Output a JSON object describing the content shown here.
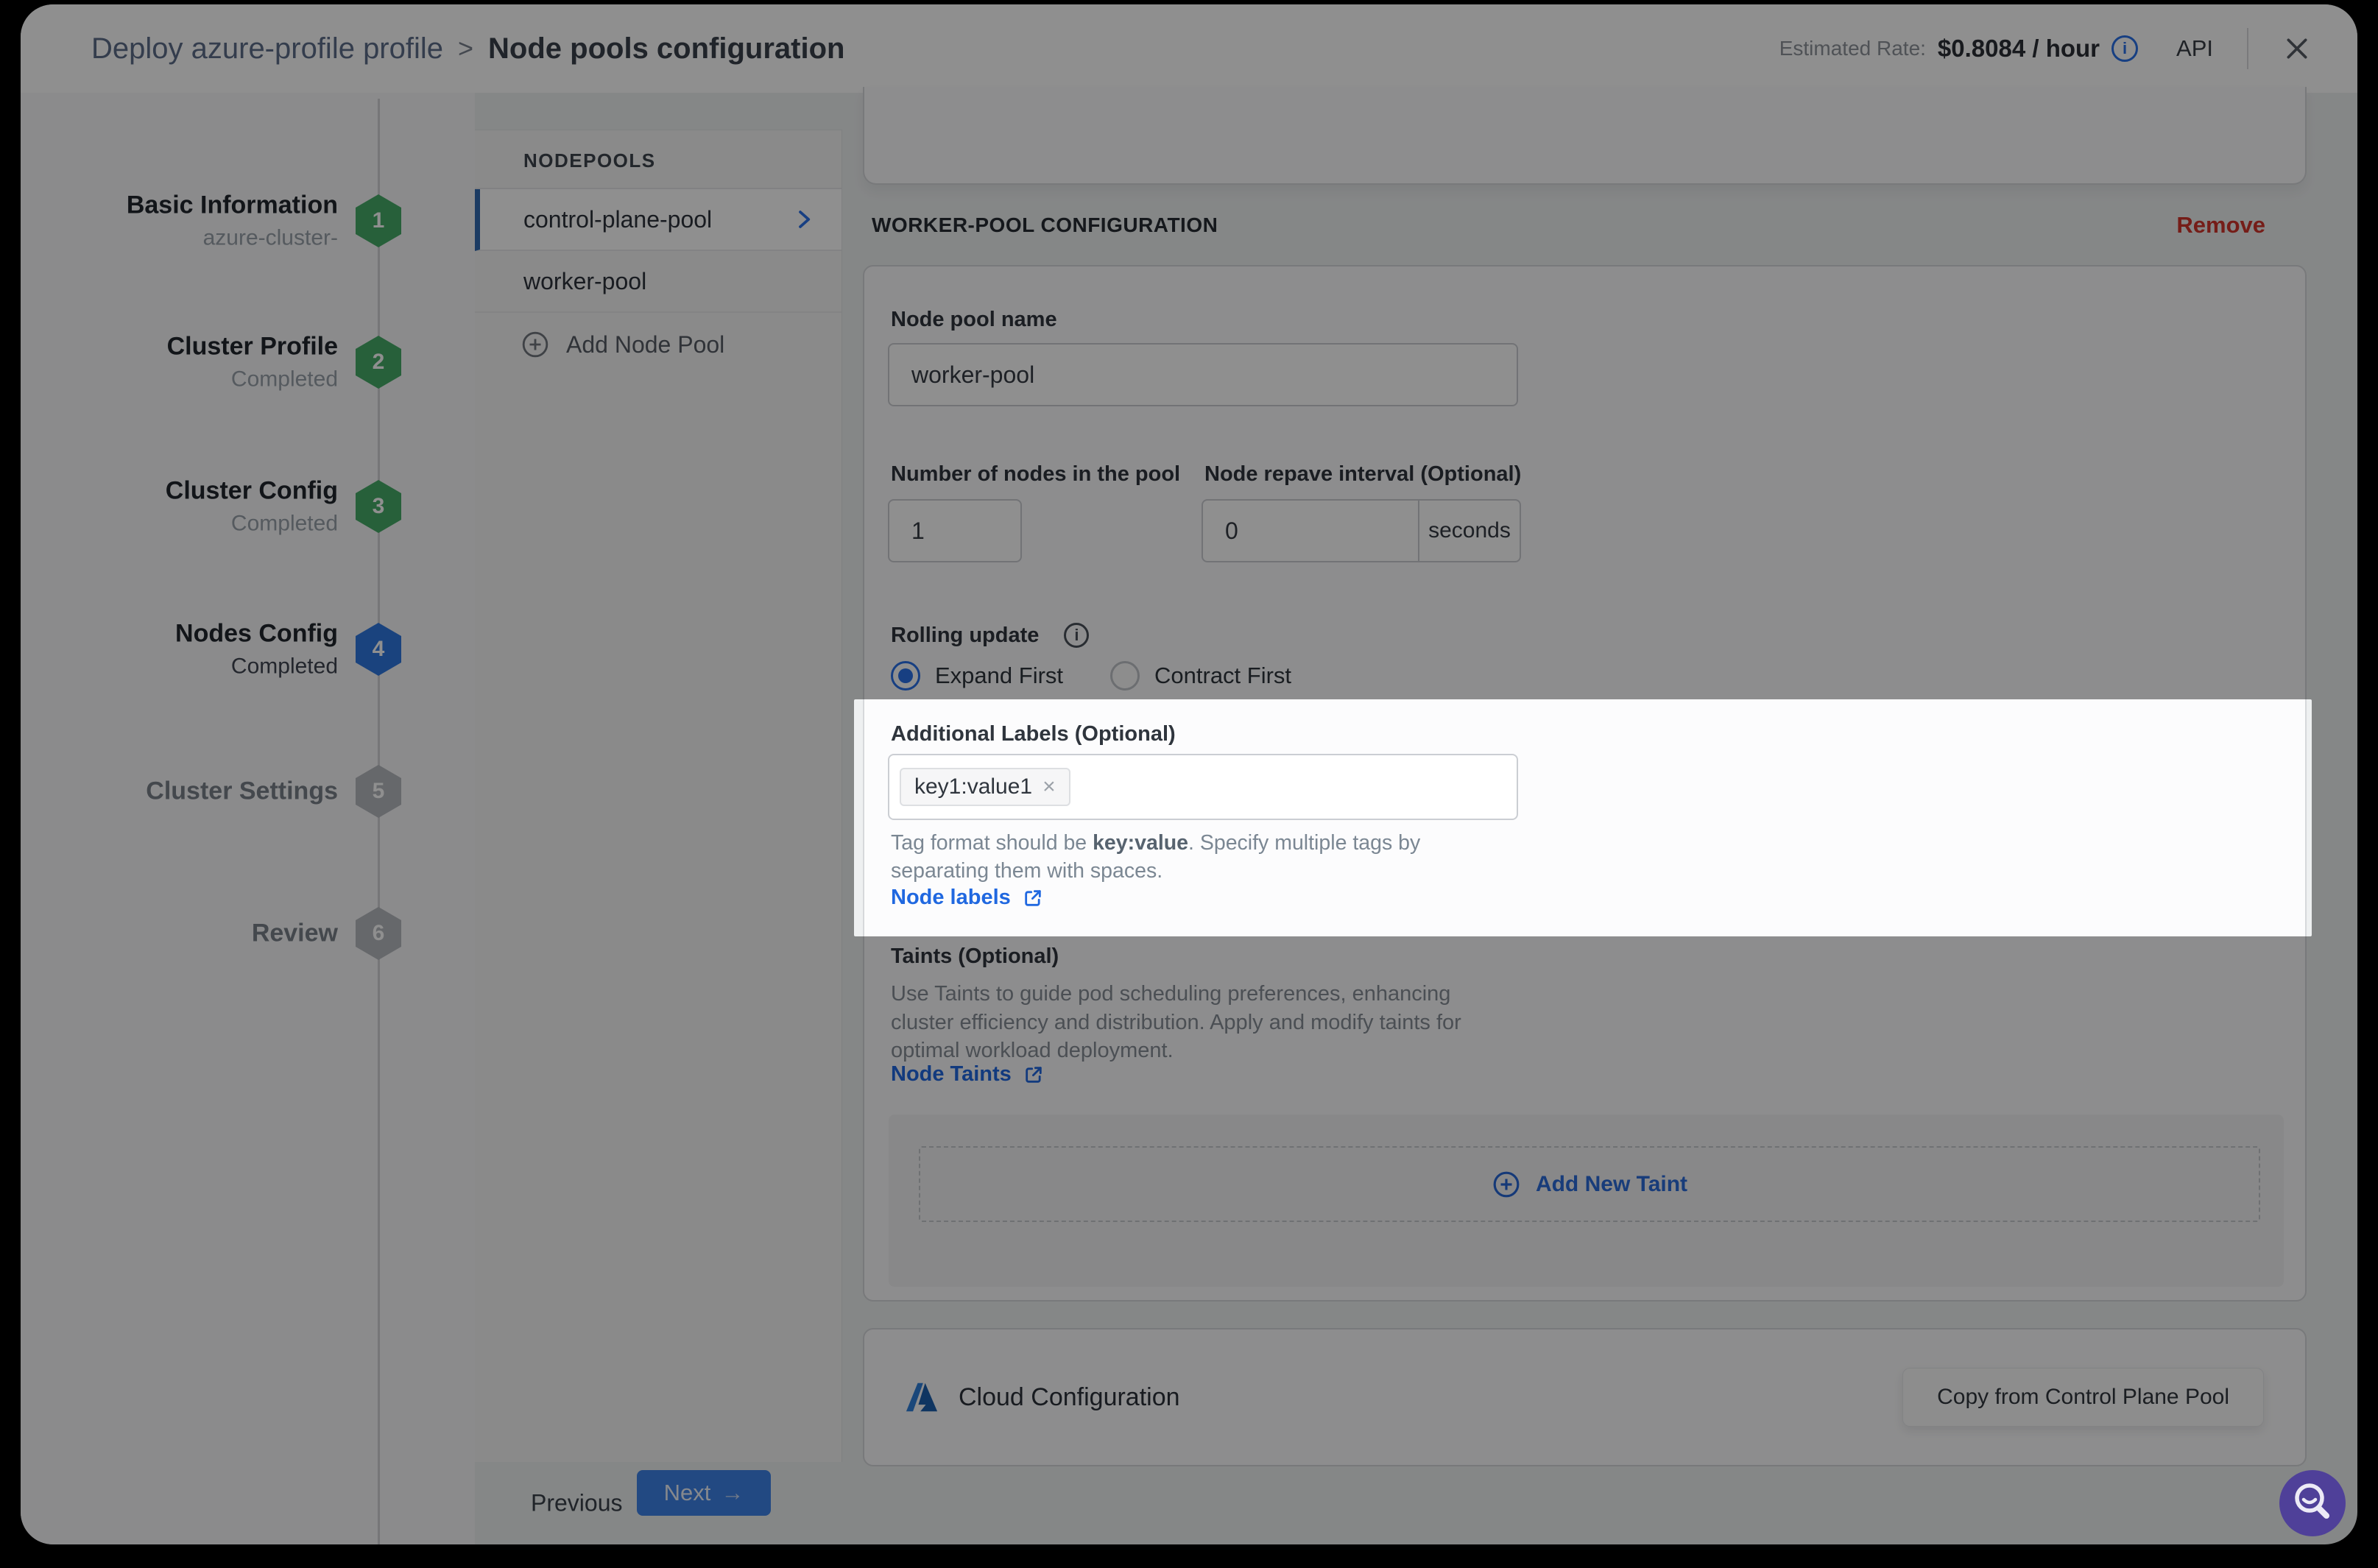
{
  "header": {
    "breadcrumb_primary": "Deploy azure-profile profile",
    "breadcrumb_separator": ">",
    "breadcrumb_secondary": "Node pools configuration",
    "estimated_rate_label": "Estimated Rate:",
    "estimated_rate_value": "$0.8084 / hour",
    "api_label": "API"
  },
  "sidebar": {
    "steps": [
      {
        "num": "1",
        "title": "Basic Information",
        "subtitle": "azure-cluster-"
      },
      {
        "num": "2",
        "title": "Cluster Profile",
        "subtitle": "Completed"
      },
      {
        "num": "3",
        "title": "Cluster Config",
        "subtitle": "Completed"
      },
      {
        "num": "4",
        "title": "Nodes Config",
        "subtitle": "Completed"
      },
      {
        "num": "5",
        "title": "Cluster Settings"
      },
      {
        "num": "6",
        "title": "Review"
      }
    ]
  },
  "nodepools": {
    "header": "NODEPOOLS",
    "items": [
      {
        "label": "control-plane-pool"
      },
      {
        "label": "worker-pool"
      }
    ],
    "add_label": "Add Node Pool"
  },
  "worker": {
    "section_title": "WORKER-POOL CONFIGURATION",
    "remove_label": "Remove",
    "name_label": "Node pool name",
    "name_value": "worker-pool",
    "count_label": "Number of nodes in the pool",
    "count_value": "1",
    "repave_label": "Node repave interval (Optional)",
    "repave_value": "0",
    "repave_unit": "seconds",
    "rolling_label": "Rolling update",
    "radio_expand": "Expand First",
    "radio_contract": "Contract First",
    "labels": {
      "label": "Additional Labels (Optional)",
      "tag": "key1:value1",
      "help_pre": "Tag format should be ",
      "help_bold": "key:value",
      "help_post": ". Specify multiple tags by separating them with spaces.",
      "link": "Node labels"
    },
    "taints": {
      "label": "Taints (Optional)",
      "description": "Use Taints to guide pod scheduling preferences, enhancing cluster efficiency and distribution. Apply and modify taints for optimal workload deployment.",
      "link": "Node Taints",
      "add_label": "Add New Taint"
    }
  },
  "cloud": {
    "title": "Cloud Configuration",
    "copy_label": "Copy from Control Plane Pool"
  },
  "footer": {
    "previous": "Previous",
    "next": "Next"
  },
  "colors": {
    "accent_blue": "#2970e8",
    "step_green": "#46ab68",
    "step_active_blue": "#2f78e0",
    "remove_red": "#d0342c",
    "assistant_purple": "#4f4099"
  }
}
